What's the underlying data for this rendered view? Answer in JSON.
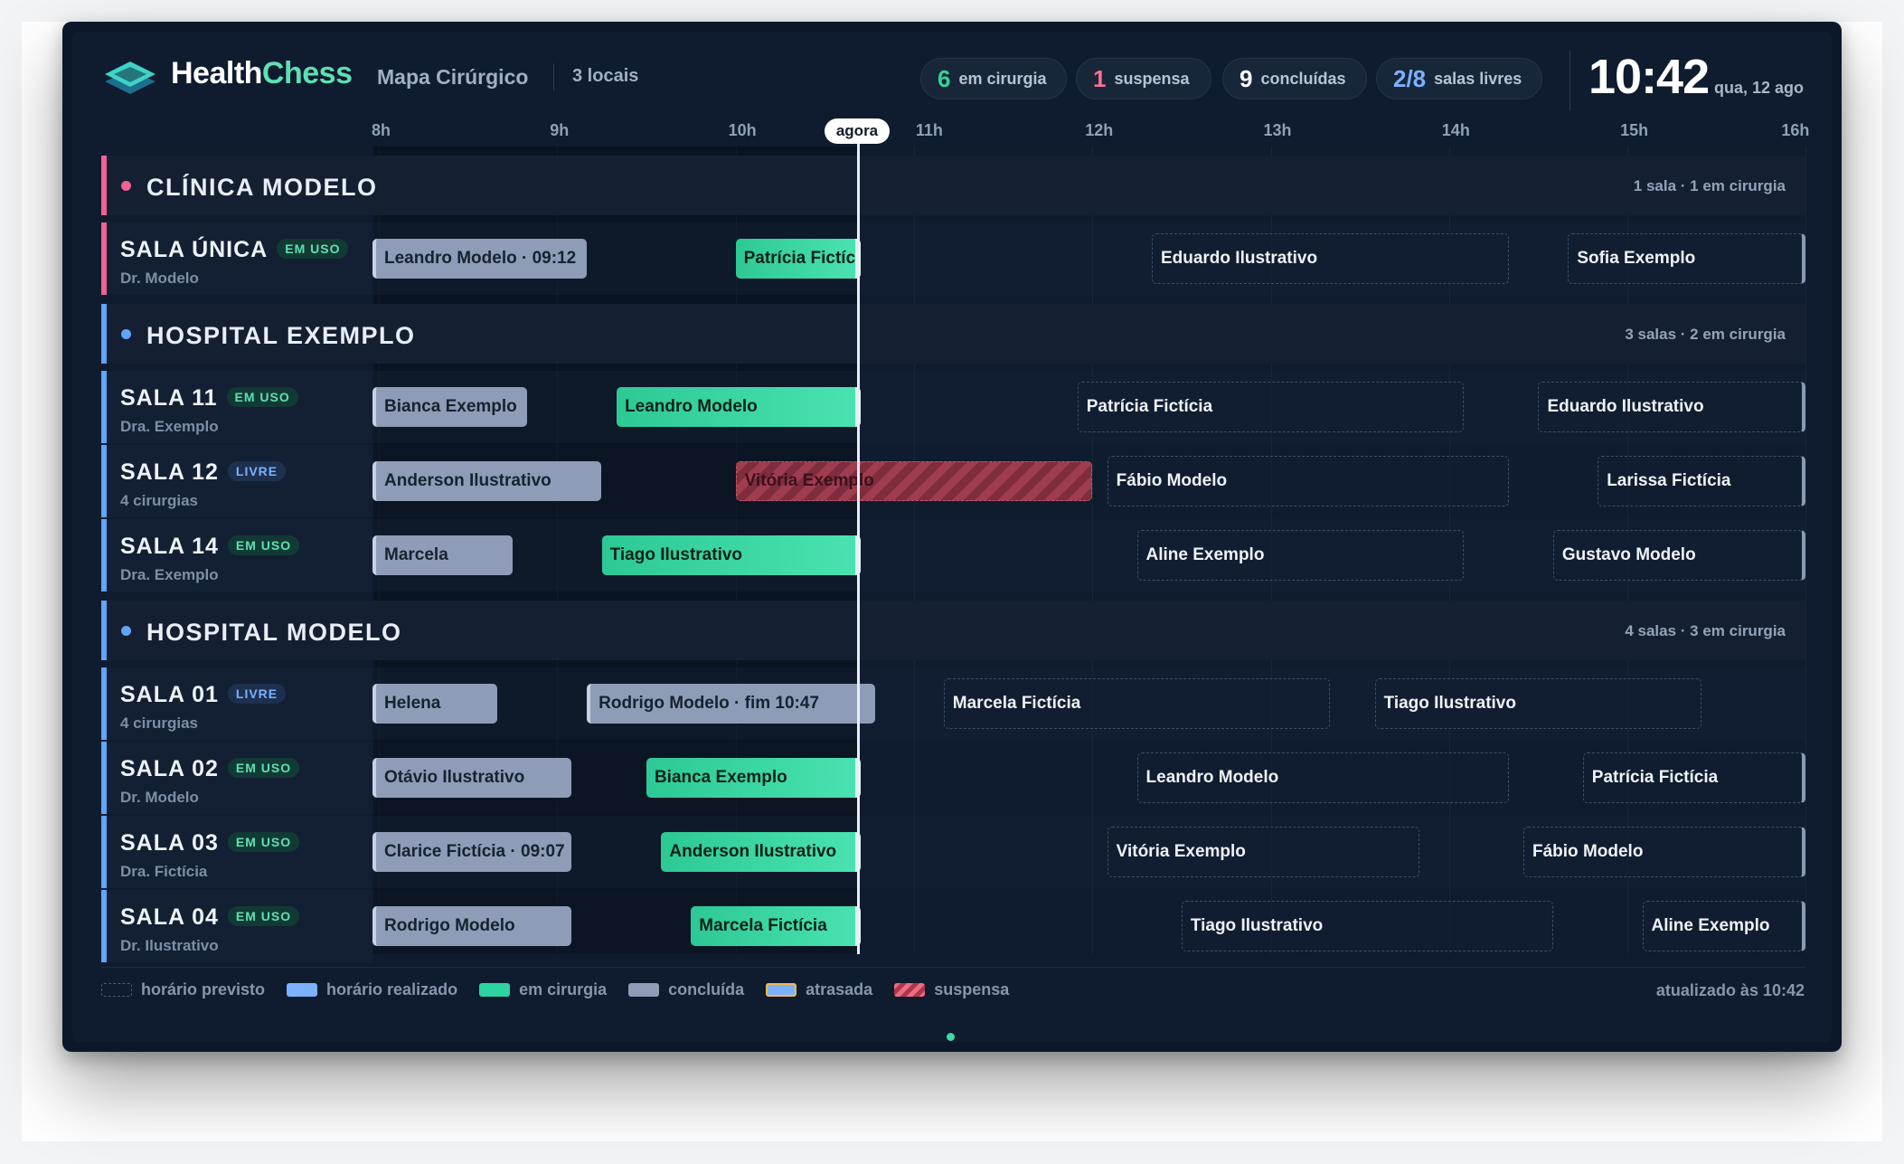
{
  "app": {
    "brand_part1": "Health",
    "brand_part2": "Chess",
    "page_title": "Mapa Cirúrgico",
    "locations_count": "3 locais"
  },
  "stats": [
    {
      "value": "6",
      "label": "em cirurgia",
      "color": "#34d399"
    },
    {
      "value": "1",
      "label": "suspensa",
      "color": "#f87190"
    },
    {
      "value": "9",
      "label": "concluídas",
      "color": "#ffffff"
    },
    {
      "value": "2/8",
      "label": "salas livres",
      "color": "#7cb1ff"
    }
  ],
  "clock": {
    "time": "10:42",
    "date": "qua, 12 ago"
  },
  "timeline": {
    "hours": [
      "8h",
      "9h",
      "10h",
      "11h",
      "12h",
      "13h",
      "14h",
      "15h",
      "16h"
    ],
    "now_label": "agora",
    "now_time": "10:42"
  },
  "groups": [
    {
      "name": "CLÍNICA MODELO",
      "meta": "1 sala · 1 em cirurgia",
      "color": "#f06292",
      "rooms": [
        {
          "name": "SALA ÚNICA",
          "status": "EM USO",
          "sub": "Dr. Modelo",
          "bars": [
            {
              "label": "Leandro Modelo · 09:12",
              "kind": "concluída",
              "start": "08:00",
              "end": "09:12"
            },
            {
              "label": "Patrícia Fictícia",
              "kind": "em cirurgia",
              "start": "10:00",
              "end": "10:42"
            },
            {
              "label": "Eduardo Ilustrativo",
              "kind": "previsto",
              "start": "12:20",
              "end": "14:20"
            },
            {
              "label": "Sofia Exemplo",
              "kind": "previsto",
              "start": "14:40",
              "end": "16:00"
            }
          ]
        }
      ]
    },
    {
      "name": "HOSPITAL EXEMPLO",
      "meta": "3 salas · 2 em cirurgia",
      "color": "#60a5fa",
      "rooms": [
        {
          "name": "SALA 11",
          "status": "EM USO",
          "sub": "Dra. Exemplo",
          "bars": [
            {
              "label": "Bianca Exemplo",
              "kind": "concluída",
              "start": "08:00",
              "end": "08:52"
            },
            {
              "label": "Leandro Modelo",
              "kind": "em cirurgia",
              "start": "09:20",
              "end": "10:42"
            },
            {
              "label": "Patrícia Fictícia",
              "kind": "previsto",
              "start": "11:55",
              "end": "14:05"
            },
            {
              "label": "Eduardo Ilustrativo",
              "kind": "previsto",
              "start": "14:30",
              "end": "16:00"
            }
          ]
        },
        {
          "name": "SALA 12",
          "status": "LIVRE",
          "sub": "4 cirurgias",
          "bars": [
            {
              "label": "Anderson Ilustrativo",
              "kind": "concluída",
              "start": "08:00",
              "end": "09:17"
            },
            {
              "label": "Vitória Exemplo",
              "kind": "suspensa",
              "start": "10:00",
              "end": "12:00"
            },
            {
              "label": "Fábio Modelo",
              "kind": "previsto",
              "start": "12:05",
              "end": "14:20"
            },
            {
              "label": "Larissa Fictícia",
              "kind": "previsto",
              "start": "14:50",
              "end": "16:00"
            }
          ]
        },
        {
          "name": "SALA 14",
          "status": "EM USO",
          "sub": "Dra. Exemplo",
          "bars": [
            {
              "label": "Marcela",
              "kind": "concluída",
              "start": "08:00",
              "end": "08:47"
            },
            {
              "label": "Tiago Ilustrativo",
              "kind": "em cirurgia",
              "start": "09:15",
              "end": "10:42"
            },
            {
              "label": "Aline Exemplo",
              "kind": "previsto",
              "start": "12:15",
              "end": "14:05"
            },
            {
              "label": "Gustavo Modelo",
              "kind": "previsto",
              "start": "14:35",
              "end": "16:00"
            }
          ]
        }
      ]
    },
    {
      "name": "HOSPITAL MODELO",
      "meta": "4 salas · 3 em cirurgia",
      "color": "#60a5fa",
      "rooms": [
        {
          "name": "SALA 01",
          "status": "LIVRE",
          "sub": "4 cirurgias",
          "bars": [
            {
              "label": "Helena",
              "kind": "concluída",
              "start": "08:00",
              "end": "08:42"
            },
            {
              "label": "Rodrigo Modelo · fim 10:47",
              "kind": "concluída",
              "start": "09:10",
              "end": "10:47"
            },
            {
              "label": "Marcela Fictícia",
              "kind": "previsto",
              "start": "11:10",
              "end": "13:20"
            },
            {
              "label": "Tiago Ilustrativo",
              "kind": "previsto",
              "start": "13:35",
              "end": "15:25"
            }
          ]
        },
        {
          "name": "SALA 02",
          "status": "EM USO",
          "sub": "Dr. Modelo",
          "bars": [
            {
              "label": "Otávio Ilustrativo",
              "kind": "concluída",
              "start": "08:00",
              "end": "09:07"
            },
            {
              "label": "Bianca Exemplo",
              "kind": "em cirurgia",
              "start": "09:30",
              "end": "10:42"
            },
            {
              "label": "Leandro Modelo",
              "kind": "previsto",
              "start": "12:15",
              "end": "14:20"
            },
            {
              "label": "Patrícia Fictícia",
              "kind": "previsto",
              "start": "14:45",
              "end": "16:00"
            }
          ]
        },
        {
          "name": "SALA 03",
          "status": "EM USO",
          "sub": "Dra. Fictícia",
          "bars": [
            {
              "label": "Clarice Fictícia · 09:07",
              "kind": "concluída",
              "start": "08:00",
              "end": "09:07"
            },
            {
              "label": "Anderson Ilustrativo",
              "kind": "em cirurgia",
              "start": "09:35",
              "end": "10:42"
            },
            {
              "label": "Vitória Exemplo",
              "kind": "previsto",
              "start": "12:05",
              "end": "13:50"
            },
            {
              "label": "Fábio Modelo",
              "kind": "previsto",
              "start": "14:25",
              "end": "16:00"
            }
          ]
        },
        {
          "name": "SALA 04",
          "status": "EM USO",
          "sub": "Dr. Ilustrativo",
          "bars": [
            {
              "label": "Rodrigo Modelo",
              "kind": "concluída",
              "start": "08:00",
              "end": "09:07"
            },
            {
              "label": "Marcela Fictícia",
              "kind": "em cirurgia",
              "start": "09:45",
              "end": "10:42"
            },
            {
              "label": "Tiago Ilustrativo",
              "kind": "previsto",
              "start": "12:30",
              "end": "14:35"
            },
            {
              "label": "Aline Exemplo",
              "kind": "previsto",
              "start": "15:05",
              "end": "16:00"
            }
          ]
        }
      ]
    }
  ],
  "legend": [
    {
      "label": "horário previsto",
      "swatch": "previsto"
    },
    {
      "label": "horário realizado",
      "swatch": "realizado"
    },
    {
      "label": "em cirurgia",
      "swatch": "em cirurgia"
    },
    {
      "label": "concluída",
      "swatch": "concluída"
    },
    {
      "label": "atrasada",
      "swatch": "atrasada"
    },
    {
      "label": "suspensa",
      "swatch": "suspensa"
    }
  ],
  "updated": "atualizado às 10:42",
  "colors": {
    "accent": "#34d399",
    "background": "#0f1b2e",
    "suspended": "#f87190",
    "free": "#7cb1ff"
  }
}
